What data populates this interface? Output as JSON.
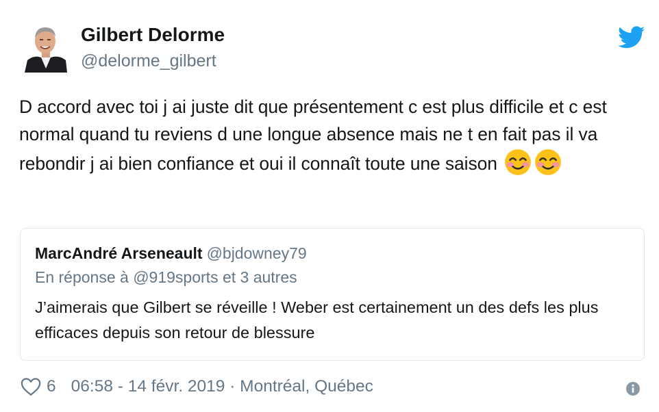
{
  "author": {
    "display_name": "Gilbert Delorme",
    "handle": "@delorme_gilbert",
    "avatar_icon": "profile-photo"
  },
  "brand": {
    "icon": "twitter-bird-icon",
    "color": "#1da1f2"
  },
  "tweet": {
    "text": "D accord avec toi j ai juste dit que présentement c est plus difficile et c est normal quand tu reviens d une longue absence mais ne t en fait pas il va rebondir j ai bien confiance et oui il connaît toute une saison",
    "emojis": [
      "smiling-face-with-smiling-eyes",
      "smiling-face-with-smiling-eyes"
    ]
  },
  "quoted_tweet": {
    "display_name": "MarcAndré Arseneault",
    "handle": "@bjdowney79",
    "reply_context": "En réponse à @919sports et 3 autres",
    "text": "J’aimerais que Gilbert se réveille ! Weber est certainement un des defs les plus efficaces depuis son retour de blessure"
  },
  "footer": {
    "like_icon": "heart-icon",
    "like_count": "6",
    "timestamp": "06:58 - 14 févr. 2019 · Montréal, Québec",
    "info_icon": "info-icon"
  }
}
